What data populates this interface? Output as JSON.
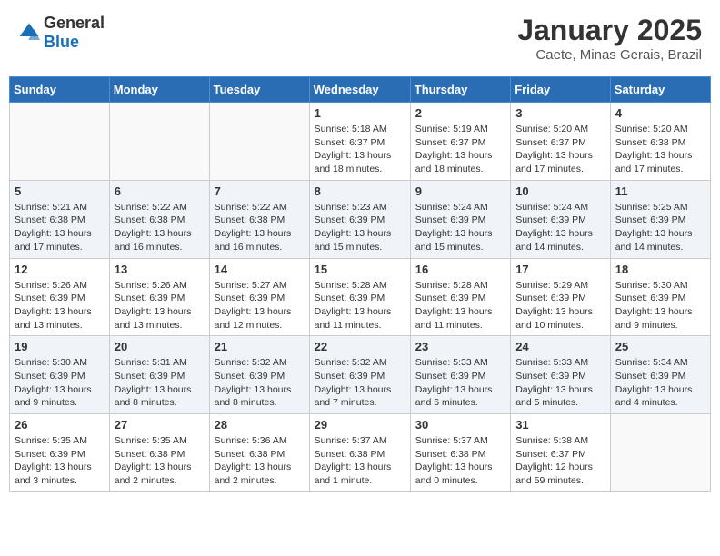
{
  "header": {
    "logo_general": "General",
    "logo_blue": "Blue",
    "month_title": "January 2025",
    "location": "Caete, Minas Gerais, Brazil"
  },
  "days_of_week": [
    "Sunday",
    "Monday",
    "Tuesday",
    "Wednesday",
    "Thursday",
    "Friday",
    "Saturday"
  ],
  "weeks": [
    [
      {
        "day": "",
        "info": ""
      },
      {
        "day": "",
        "info": ""
      },
      {
        "day": "",
        "info": ""
      },
      {
        "day": "1",
        "info": "Sunrise: 5:18 AM\nSunset: 6:37 PM\nDaylight: 13 hours\nand 18 minutes."
      },
      {
        "day": "2",
        "info": "Sunrise: 5:19 AM\nSunset: 6:37 PM\nDaylight: 13 hours\nand 18 minutes."
      },
      {
        "day": "3",
        "info": "Sunrise: 5:20 AM\nSunset: 6:37 PM\nDaylight: 13 hours\nand 17 minutes."
      },
      {
        "day": "4",
        "info": "Sunrise: 5:20 AM\nSunset: 6:38 PM\nDaylight: 13 hours\nand 17 minutes."
      }
    ],
    [
      {
        "day": "5",
        "info": "Sunrise: 5:21 AM\nSunset: 6:38 PM\nDaylight: 13 hours\nand 17 minutes."
      },
      {
        "day": "6",
        "info": "Sunrise: 5:22 AM\nSunset: 6:38 PM\nDaylight: 13 hours\nand 16 minutes."
      },
      {
        "day": "7",
        "info": "Sunrise: 5:22 AM\nSunset: 6:38 PM\nDaylight: 13 hours\nand 16 minutes."
      },
      {
        "day": "8",
        "info": "Sunrise: 5:23 AM\nSunset: 6:39 PM\nDaylight: 13 hours\nand 15 minutes."
      },
      {
        "day": "9",
        "info": "Sunrise: 5:24 AM\nSunset: 6:39 PM\nDaylight: 13 hours\nand 15 minutes."
      },
      {
        "day": "10",
        "info": "Sunrise: 5:24 AM\nSunset: 6:39 PM\nDaylight: 13 hours\nand 14 minutes."
      },
      {
        "day": "11",
        "info": "Sunrise: 5:25 AM\nSunset: 6:39 PM\nDaylight: 13 hours\nand 14 minutes."
      }
    ],
    [
      {
        "day": "12",
        "info": "Sunrise: 5:26 AM\nSunset: 6:39 PM\nDaylight: 13 hours\nand 13 minutes."
      },
      {
        "day": "13",
        "info": "Sunrise: 5:26 AM\nSunset: 6:39 PM\nDaylight: 13 hours\nand 13 minutes."
      },
      {
        "day": "14",
        "info": "Sunrise: 5:27 AM\nSunset: 6:39 PM\nDaylight: 13 hours\nand 12 minutes."
      },
      {
        "day": "15",
        "info": "Sunrise: 5:28 AM\nSunset: 6:39 PM\nDaylight: 13 hours\nand 11 minutes."
      },
      {
        "day": "16",
        "info": "Sunrise: 5:28 AM\nSunset: 6:39 PM\nDaylight: 13 hours\nand 11 minutes."
      },
      {
        "day": "17",
        "info": "Sunrise: 5:29 AM\nSunset: 6:39 PM\nDaylight: 13 hours\nand 10 minutes."
      },
      {
        "day": "18",
        "info": "Sunrise: 5:30 AM\nSunset: 6:39 PM\nDaylight: 13 hours\nand 9 minutes."
      }
    ],
    [
      {
        "day": "19",
        "info": "Sunrise: 5:30 AM\nSunset: 6:39 PM\nDaylight: 13 hours\nand 9 minutes."
      },
      {
        "day": "20",
        "info": "Sunrise: 5:31 AM\nSunset: 6:39 PM\nDaylight: 13 hours\nand 8 minutes."
      },
      {
        "day": "21",
        "info": "Sunrise: 5:32 AM\nSunset: 6:39 PM\nDaylight: 13 hours\nand 8 minutes."
      },
      {
        "day": "22",
        "info": "Sunrise: 5:32 AM\nSunset: 6:39 PM\nDaylight: 13 hours\nand 7 minutes."
      },
      {
        "day": "23",
        "info": "Sunrise: 5:33 AM\nSunset: 6:39 PM\nDaylight: 13 hours\nand 6 minutes."
      },
      {
        "day": "24",
        "info": "Sunrise: 5:33 AM\nSunset: 6:39 PM\nDaylight: 13 hours\nand 5 minutes."
      },
      {
        "day": "25",
        "info": "Sunrise: 5:34 AM\nSunset: 6:39 PM\nDaylight: 13 hours\nand 4 minutes."
      }
    ],
    [
      {
        "day": "26",
        "info": "Sunrise: 5:35 AM\nSunset: 6:39 PM\nDaylight: 13 hours\nand 3 minutes."
      },
      {
        "day": "27",
        "info": "Sunrise: 5:35 AM\nSunset: 6:38 PM\nDaylight: 13 hours\nand 2 minutes."
      },
      {
        "day": "28",
        "info": "Sunrise: 5:36 AM\nSunset: 6:38 PM\nDaylight: 13 hours\nand 2 minutes."
      },
      {
        "day": "29",
        "info": "Sunrise: 5:37 AM\nSunset: 6:38 PM\nDaylight: 13 hours\nand 1 minute."
      },
      {
        "day": "30",
        "info": "Sunrise: 5:37 AM\nSunset: 6:38 PM\nDaylight: 13 hours\nand 0 minutes."
      },
      {
        "day": "31",
        "info": "Sunrise: 5:38 AM\nSunset: 6:37 PM\nDaylight: 12 hours\nand 59 minutes."
      },
      {
        "day": "",
        "info": ""
      }
    ]
  ]
}
